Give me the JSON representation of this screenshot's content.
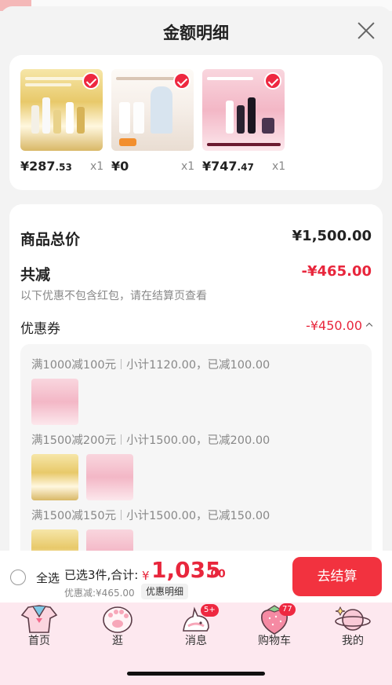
{
  "sheet": {
    "title": "金额明细"
  },
  "products": [
    {
      "price_int": "¥287",
      "price_dec": ".53",
      "qty": "x1"
    },
    {
      "price_int": "¥0",
      "price_dec": "",
      "qty": "x1"
    },
    {
      "price_int": "¥747",
      "price_dec": ".47",
      "qty": "x1"
    }
  ],
  "summary": {
    "goods_label": "商品总价",
    "goods_value": "¥1,500.00",
    "reduce_label": "共减",
    "reduce_value": "-¥465.00",
    "reduce_note": "以下优惠不包含红包，请在结算页查看",
    "coupon_label": "优惠券",
    "coupon_value": "-¥450.00"
  },
  "coupon_rules": [
    {
      "title": "满1000减100元",
      "detail": "小计1120.00，已减100.00"
    },
    {
      "title": "满1500减200元",
      "detail": "小计1500.00，已减200.00"
    },
    {
      "title": "满1500减150元",
      "detail": "小计1500.00，已减150.00"
    }
  ],
  "footer": {
    "select_all": "全选",
    "summary_text": "已选3件,合计:",
    "currency": "¥",
    "total_int": "1,035",
    "total_dec": ".00",
    "discount_text": "优惠减:¥465.00",
    "detail_label": "优惠明细",
    "checkout_label": "去结算"
  },
  "tabs": [
    {
      "label": "首页",
      "icon": "sailor-shirt-icon"
    },
    {
      "label": "逛",
      "icon": "cat-paw-icon"
    },
    {
      "label": "消息",
      "icon": "unicorn-icon",
      "badge": "5+"
    },
    {
      "label": "购物车",
      "icon": "strawberry-icon",
      "badge": "77"
    },
    {
      "label": "我的",
      "icon": "planet-icon"
    }
  ],
  "colors": {
    "accent": "#ee2840",
    "checkout": "#f2323f",
    "tabbar_bg": "#fde8ef"
  }
}
